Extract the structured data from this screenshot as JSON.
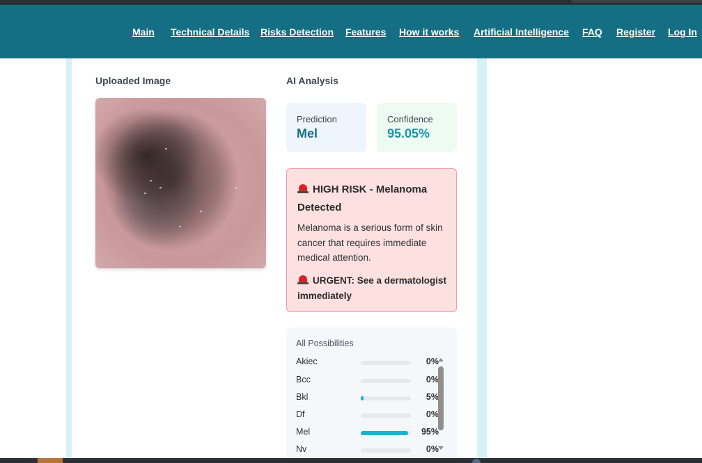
{
  "nav": {
    "links": [
      "Main",
      "Technical Details",
      "Risks Detection",
      "Features",
      "How it works",
      "Artificial Intelligence",
      "FAQ",
      "Register",
      "Log In"
    ]
  },
  "uploaded": {
    "title": "Uploaded Image"
  },
  "analysis": {
    "title": "AI Analysis",
    "prediction_label": "Prediction",
    "prediction_value": "Mel",
    "confidence_label": "Confidence",
    "confidence_value": "95.05%"
  },
  "alert": {
    "title": "HIGH RISK - Melanoma Detected",
    "body": "Melanoma is a serious form of skin cancer that requires immediate medical attention.",
    "urgent": "URGENT: See a dermatologist immediately",
    "icon": "siren-icon"
  },
  "possibilities": {
    "title": "All Possibilities",
    "items": [
      {
        "name": "Akiec",
        "pct": "0%",
        "value": 0
      },
      {
        "name": "Bcc",
        "pct": "0%",
        "value": 0
      },
      {
        "name": "Bkl",
        "pct": "5%",
        "value": 5
      },
      {
        "name": "Df",
        "pct": "0%",
        "value": 0
      },
      {
        "name": "Mel",
        "pct": "95%",
        "value": 95
      },
      {
        "name": "Nv",
        "pct": "0%",
        "value": 0
      }
    ]
  },
  "colors": {
    "navbar": "#156f84",
    "accent_value": "#1a6f87",
    "confidence_value": "#1894a8",
    "bar_fill": "#17b4cf",
    "alert_bg": "#fde0e0",
    "alert_border": "#f19ea4"
  }
}
